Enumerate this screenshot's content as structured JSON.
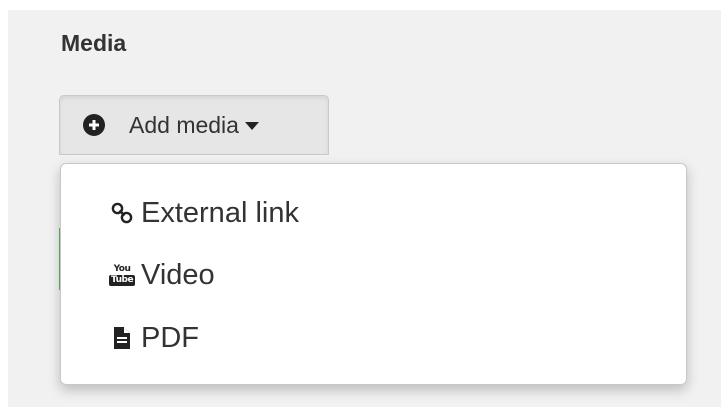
{
  "section": {
    "title": "Media"
  },
  "add_media_button": {
    "label": "Add media",
    "icon": "plus-circle-icon"
  },
  "dropdown": {
    "items": [
      {
        "label": "External link",
        "icon": "link-icon"
      },
      {
        "label": "Video",
        "icon": "youtube-icon",
        "icon_text_top": "You",
        "icon_text_bottom": "Tube"
      },
      {
        "label": "PDF",
        "icon": "file-pdf-icon"
      }
    ]
  },
  "colors": {
    "panel_background": "#f1f1f1",
    "button_background": "#e6e6e6",
    "menu_background": "#ffffff",
    "accent_green": "#5cb85c",
    "text": "#333333"
  }
}
